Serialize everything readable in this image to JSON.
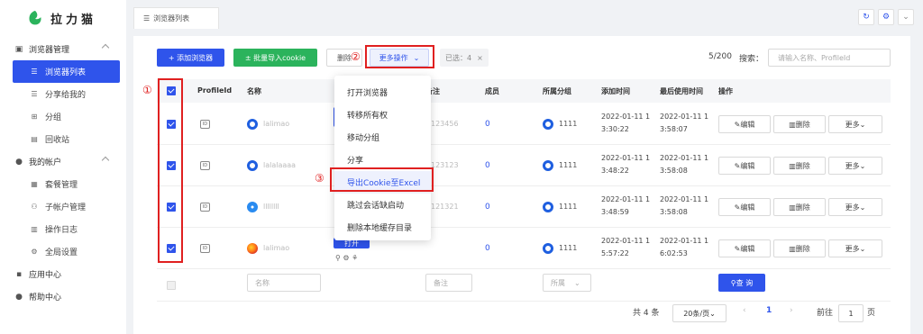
{
  "app": {
    "name": "拉力猫",
    "brand_color": "#2f54eb"
  },
  "sidebar": {
    "groups": [
      {
        "label": "浏览器管理",
        "icon": "browser-icon",
        "items": [
          {
            "label": "浏览器列表",
            "icon": "list-icon",
            "active": true
          },
          {
            "label": "分享给我的",
            "icon": "share-list-icon"
          },
          {
            "label": "分组",
            "icon": "group-icon"
          },
          {
            "label": "回收站",
            "icon": "trash-icon"
          }
        ]
      },
      {
        "label": "我的帐户",
        "icon": "user-icon",
        "items": [
          {
            "label": "套餐管理",
            "icon": "package-icon"
          },
          {
            "label": "子帐户管理",
            "icon": "sub-account-icon"
          },
          {
            "label": "操作日志",
            "icon": "log-icon"
          },
          {
            "label": "全局设置",
            "icon": "settings-icon"
          }
        ]
      },
      {
        "label": "应用中心",
        "icon": "app-grid-icon"
      },
      {
        "label": "帮助中心",
        "icon": "help-icon"
      }
    ]
  },
  "topbar": {
    "tab_label": "浏览器列表"
  },
  "toolbar": {
    "add_label": "+ 添加浏览器",
    "import_label": "± 批量导入cookie",
    "delete_label": "删除",
    "more_label": "更多操作",
    "selected_label": "已选：4",
    "count": "5/200",
    "search_label": "搜索：",
    "search_placeholder": "请输入名称、ProfileId"
  },
  "table": {
    "headers": [
      "ProfileId",
      "名称",
      "备注",
      "成员",
      "所属分组",
      "添加时间",
      "最后使用时间",
      "操作"
    ],
    "rows": [
      {
        "name": "lalimao",
        "icon": "ring",
        "note": "123456",
        "member": "0",
        "group": "1111",
        "added": [
          "2022-01-11 1",
          "3:30:22"
        ],
        "last": [
          "2022-01-11 1",
          "3:58:07"
        ]
      },
      {
        "name": "lalalaaaa",
        "icon": "ring",
        "note": "123123",
        "member": "0",
        "group": "1111",
        "added": [
          "2022-01-11 1",
          "3:48:22"
        ],
        "last": [
          "2022-01-11 1",
          "3:58:08"
        ]
      },
      {
        "name": "llllllll",
        "icon": "safari",
        "note": "121321",
        "member": "0",
        "group": "1111",
        "added": [
          "2022-01-11 1",
          "3:48:59"
        ],
        "last": [
          "2022-01-11 1",
          "3:58:08"
        ]
      },
      {
        "name": "lalimao",
        "icon": "firefox",
        "note": "",
        "member": "0",
        "group": "1111",
        "added": [
          "2022-01-11 1",
          "5:57:22"
        ],
        "last": [
          "2022-01-11 1",
          "6:02:53"
        ]
      }
    ],
    "actions": {
      "edit": "编辑",
      "delete": "删除",
      "more": "更多"
    },
    "open_label": "打开",
    "filter": {
      "name_placeholder": "名称",
      "note_placeholder": "备注",
      "group_placeholder": "所属",
      "query_label": "查 询"
    }
  },
  "pagination": {
    "total": "共 4 条",
    "page_size": "20条/页",
    "current": "1",
    "goto_label": "前往",
    "goto_value": "1",
    "page_unit": "页"
  },
  "dropdown": {
    "items": [
      "打开浏览器",
      "转移所有权",
      "移动分组",
      "分享",
      "导出Cookie至Excel",
      "跳过会话缺启动",
      "删除本地缓存目录"
    ],
    "highlighted_index": 4
  },
  "annotations": [
    "①",
    "②",
    "③"
  ]
}
